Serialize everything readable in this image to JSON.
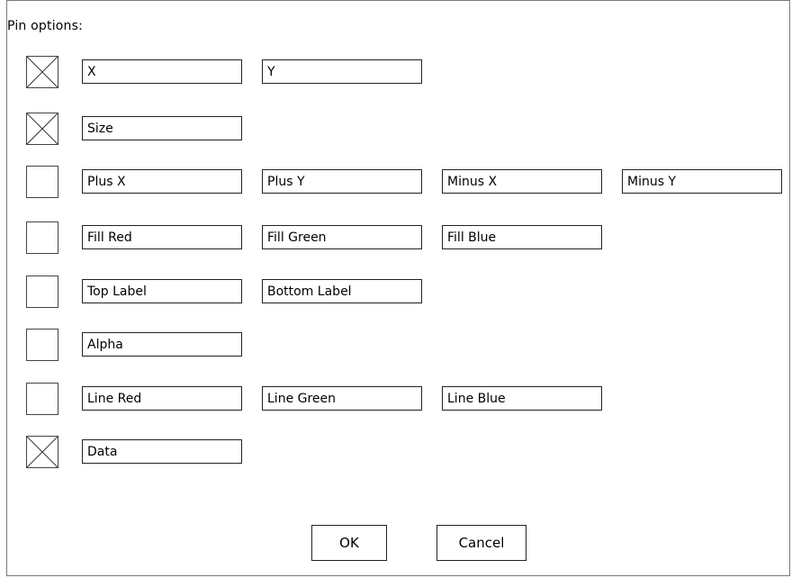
{
  "dialog": {
    "title": "Pin options:",
    "rows": [
      {
        "checked": true,
        "fields": [
          "X",
          "Y"
        ]
      },
      {
        "checked": true,
        "fields": [
          "Size"
        ]
      },
      {
        "checked": false,
        "fields": [
          "Plus X",
          "Plus Y",
          "Minus X",
          "Minus Y"
        ]
      },
      {
        "checked": false,
        "fields": [
          "Fill Red",
          "Fill Green",
          "Fill Blue"
        ]
      },
      {
        "checked": false,
        "fields": [
          "Top Label",
          "Bottom Label"
        ]
      },
      {
        "checked": false,
        "fields": [
          "Alpha"
        ]
      },
      {
        "checked": false,
        "fields": [
          "Line Red",
          "Line Green",
          "Line Blue"
        ]
      },
      {
        "checked": true,
        "fields": [
          "Data"
        ]
      }
    ],
    "ok_label": "OK",
    "cancel_label": "Cancel"
  }
}
